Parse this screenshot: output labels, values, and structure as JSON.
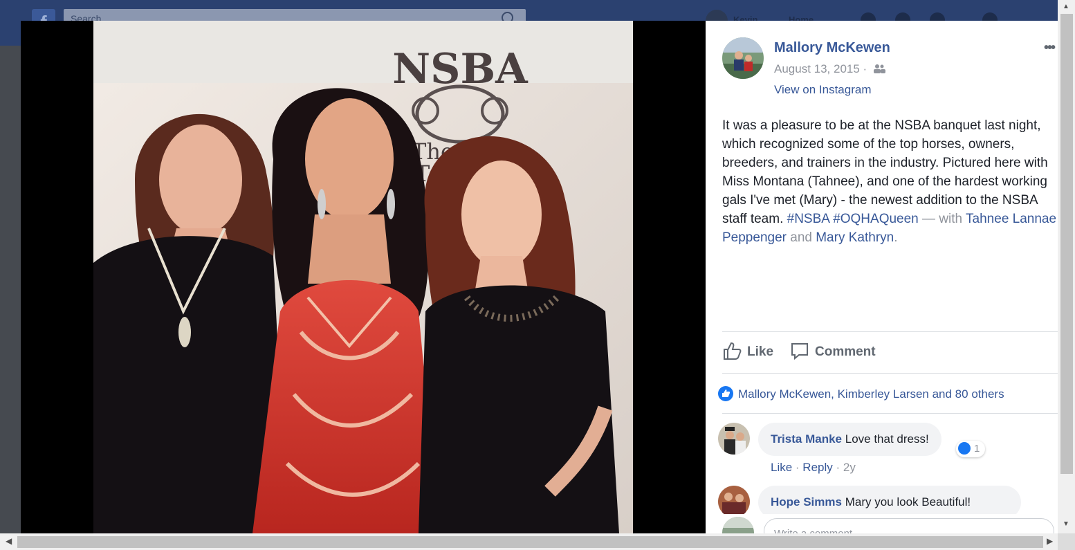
{
  "header": {
    "search_placeholder": "Search",
    "user_name": "Kevin",
    "home_label": "Home"
  },
  "post": {
    "author": "Mallory McKewen",
    "date": "August 13, 2015",
    "date_separator": " · ",
    "audience_icon": "friends-icon",
    "view_on_instagram": "View on Instagram",
    "text_main": "It was a pleasure to be at the NSBA banquet last night, which recognized some of the top horses, owners, breeders, and trainers in the industry. Pictured here with Miss Montana (Tahnee), and one of the hardest working gals I've met (Mary) - the newest addition to the NSBA staff team. ",
    "hashtag1": "#NSBA",
    "hashtag2": "#OQHAQueen",
    "with_text": " — with ",
    "tag1": "Tahnee Lannae Peppenger",
    "and_text": " and ",
    "tag2": "Mary Kathryn",
    "period": ".",
    "more_icon": "•••"
  },
  "photo": {
    "backdrop_logo": "NSBA",
    "backdrop_tagline_1": "The Wa",
    "backdrop_tagline_2": "To Go"
  },
  "actions": {
    "like": "Like",
    "comment": "Comment"
  },
  "reactions": {
    "summary": "Mallory McKewen, Kimberley Larsen and 80 others"
  },
  "comments": [
    {
      "name": "Trista Manke",
      "text": "Love that dress!",
      "reaction_count": "1",
      "like": "Like",
      "reply": "Reply",
      "dot": " · ",
      "age": "2y"
    },
    {
      "name": "Hope Simms",
      "text": "Mary you look Beautiful!"
    }
  ],
  "comment_box": {
    "placeholder": "Write a comment..."
  },
  "colors": {
    "link": "#385898",
    "like_blue": "#1877f2",
    "header": "#2b4170"
  }
}
